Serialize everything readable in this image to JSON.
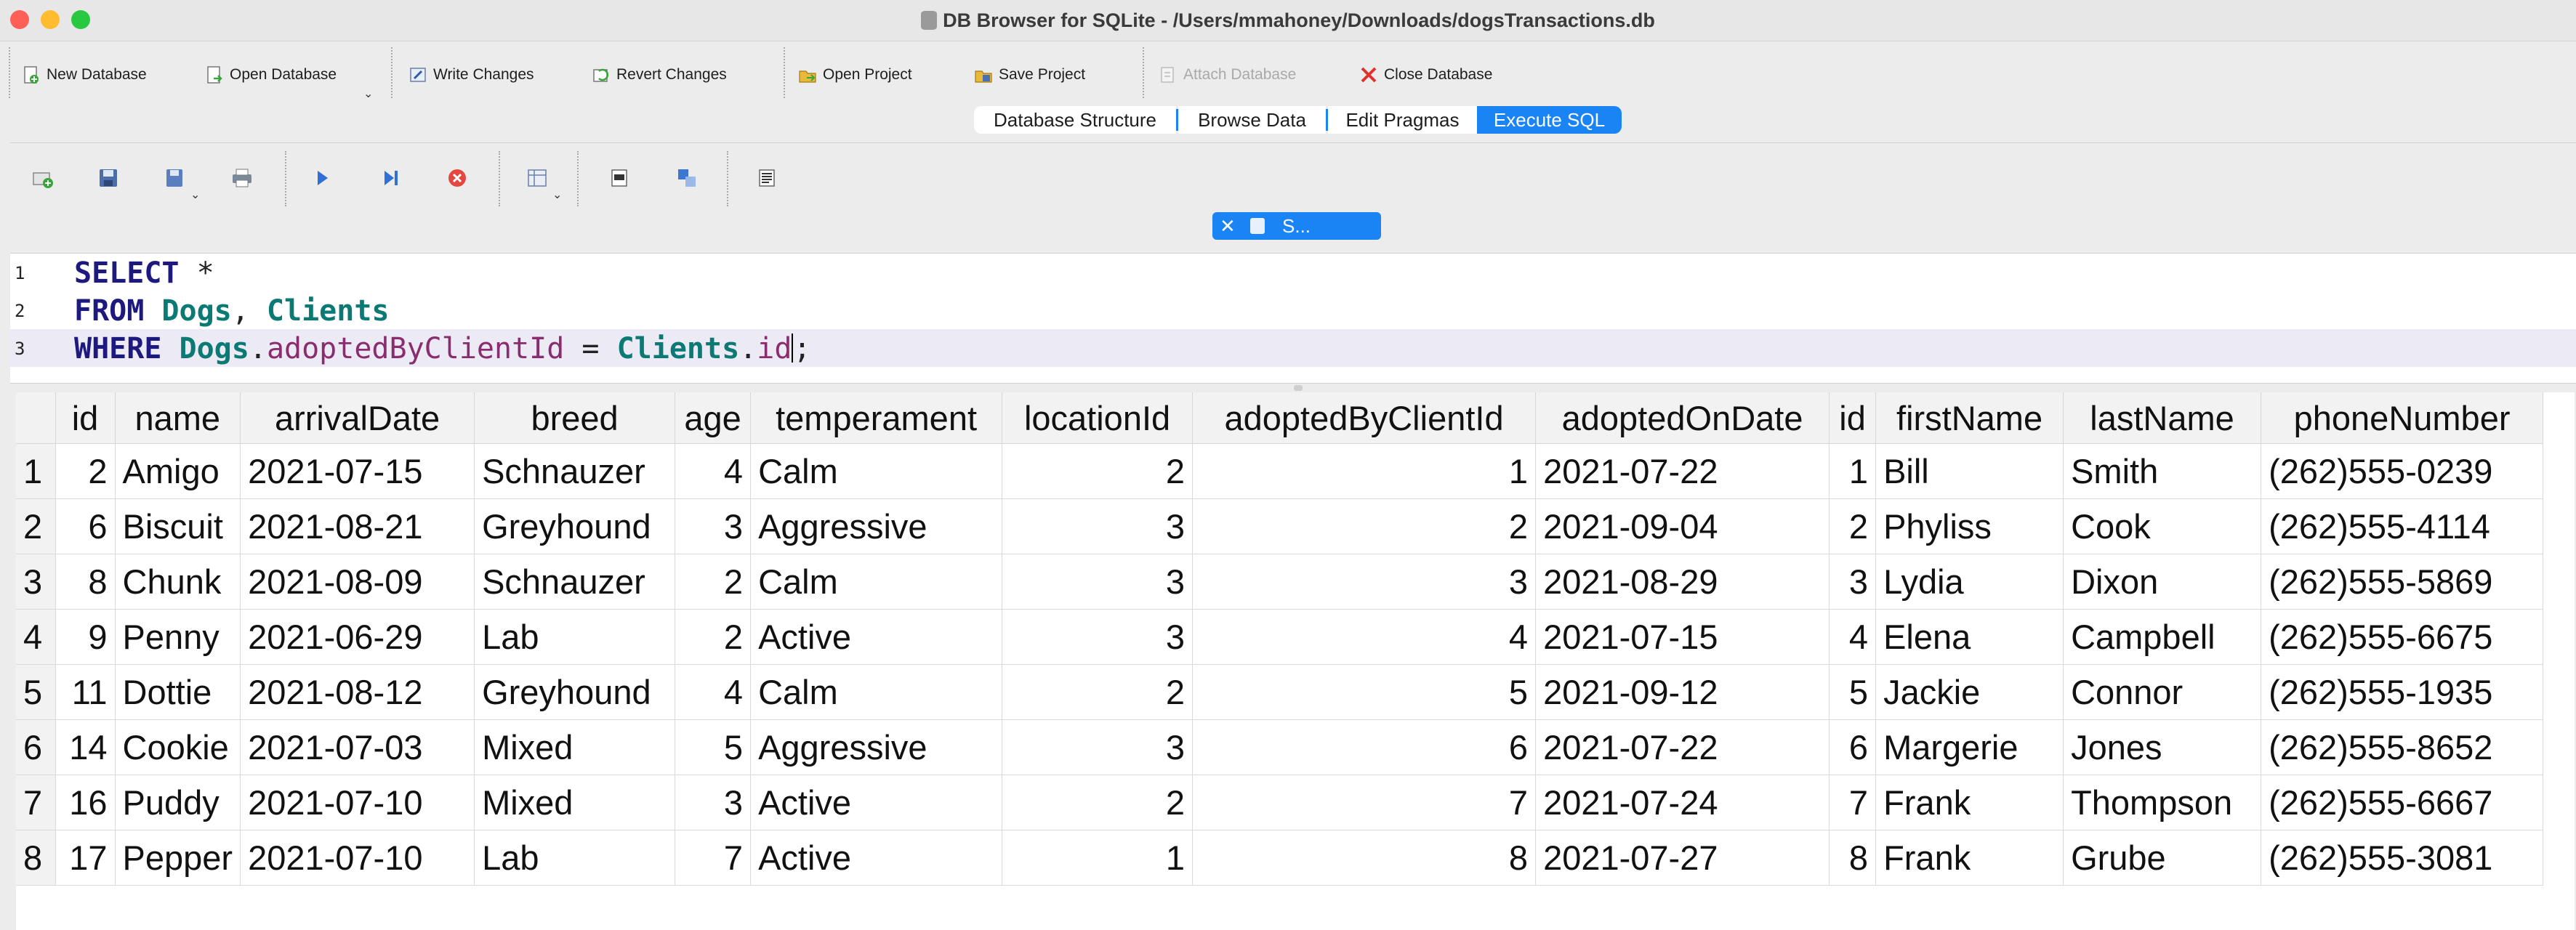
{
  "window": {
    "title": "DB Browser for SQLite - /Users/mmahoney/Downloads/dogsTransactions.db"
  },
  "toolbar": {
    "new_database": "New Database",
    "open_database": "Open Database",
    "write_changes": "Write Changes",
    "revert_changes": "Revert Changes",
    "open_project": "Open Project",
    "save_project": "Save Project",
    "attach_database": "Attach Database",
    "close_database": "Close Database"
  },
  "tabs": {
    "database_structure": "Database Structure",
    "browse_data": "Browse Data",
    "edit_pragmas": "Edit Pragmas",
    "execute_sql": "Execute SQL"
  },
  "editor": {
    "tab_label": "S...",
    "line_numbers": [
      "1",
      "2",
      "3"
    ],
    "line1": {
      "kw": "SELECT",
      "rest": " *"
    },
    "line2": {
      "kw": "FROM",
      "t1": "Dogs",
      "sep": ", ",
      "t2": "Clients"
    },
    "line3": {
      "kw": "WHERE",
      "t1": "Dogs",
      "dot1": ".",
      "c1": "adoptedByClientId",
      "eq": " = ",
      "t2": "Clients",
      "dot2": ".",
      "c2": "id",
      "end": ";"
    }
  },
  "results": {
    "columns": [
      "id",
      "name",
      "arrivalDate",
      "breed",
      "age",
      "temperament",
      "locationId",
      "adoptedByClientId",
      "adoptedOnDate",
      "id",
      "firstName",
      "lastName",
      "phoneNumber"
    ],
    "rows": [
      [
        "1",
        "2",
        "Amigo",
        "2021-07-15",
        "Schnauzer",
        "4",
        "Calm",
        "2",
        "1",
        "2021-07-22",
        "1",
        "Bill",
        "Smith",
        "(262)555-0239"
      ],
      [
        "2",
        "6",
        "Biscuit",
        "2021-08-21",
        "Greyhound",
        "3",
        "Aggressive",
        "3",
        "2",
        "2021-09-04",
        "2",
        "Phyliss",
        "Cook",
        "(262)555-4114"
      ],
      [
        "3",
        "8",
        "Chunk",
        "2021-08-09",
        "Schnauzer",
        "2",
        "Calm",
        "3",
        "3",
        "2021-08-29",
        "3",
        "Lydia",
        "Dixon",
        "(262)555-5869"
      ],
      [
        "4",
        "9",
        "Penny",
        "2021-06-29",
        "Lab",
        "2",
        "Active",
        "3",
        "4",
        "2021-07-15",
        "4",
        "Elena",
        "Campbell",
        "(262)555-6675"
      ],
      [
        "5",
        "11",
        "Dottie",
        "2021-08-12",
        "Greyhound",
        "4",
        "Calm",
        "2",
        "5",
        "2021-09-12",
        "5",
        "Jackie",
        "Connor",
        "(262)555-1935"
      ],
      [
        "6",
        "14",
        "Cookie",
        "2021-07-03",
        "Mixed",
        "5",
        "Aggressive",
        "3",
        "6",
        "2021-07-22",
        "6",
        "Margerie",
        "Jones",
        "(262)555-8652"
      ],
      [
        "7",
        "16",
        "Puddy",
        "2021-07-10",
        "Mixed",
        "3",
        "Active",
        "2",
        "7",
        "2021-07-24",
        "7",
        "Frank",
        "Thompson",
        "(262)555-6667"
      ],
      [
        "8",
        "17",
        "Pepper",
        "2021-07-10",
        "Lab",
        "7",
        "Active",
        "1",
        "8",
        "2021-07-27",
        "8",
        "Frank",
        "Grube",
        "(262)555-3081"
      ]
    ]
  }
}
